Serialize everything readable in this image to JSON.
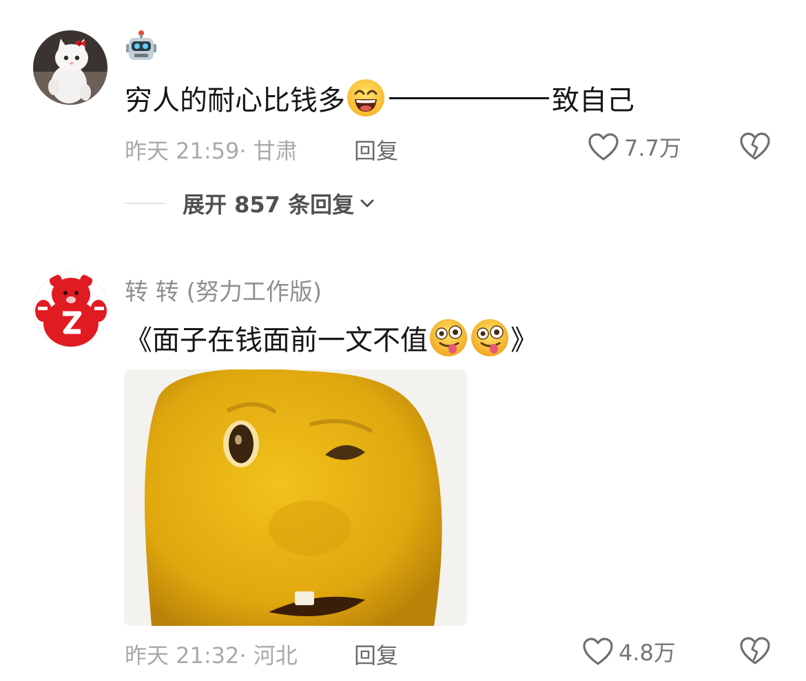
{
  "comments": [
    {
      "username": "",
      "avatar_icon": "white-kitten-avatar",
      "name_emoji_icon": "robot-emoji-icon",
      "text_before": "穷人的耐心比钱多",
      "text_emoji_icon": "grinning-smiling-eyes-emoji",
      "text_after": "致自己",
      "meta": "昨天 21:59· 甘肃",
      "reply_label": "回复",
      "likes": "7.7万",
      "expand_label": "展开 857 条回复"
    },
    {
      "username": "转 转 (努力工作版)",
      "avatar_icon": "red-bear-mascot-avatar",
      "text_before": "《面子在钱面前一文不值",
      "text_emoji_icon": "zany-face-emoji",
      "text_after": "》",
      "image_icon": "yellow-face-meme-image",
      "meta": "昨天 21:32· 河北",
      "reply_label": "回复",
      "likes": "4.8万"
    }
  ],
  "colors": {
    "meta_gray": "#a9a9a9",
    "username_gray": "#8f8f8f",
    "text_dark": "#161616"
  }
}
